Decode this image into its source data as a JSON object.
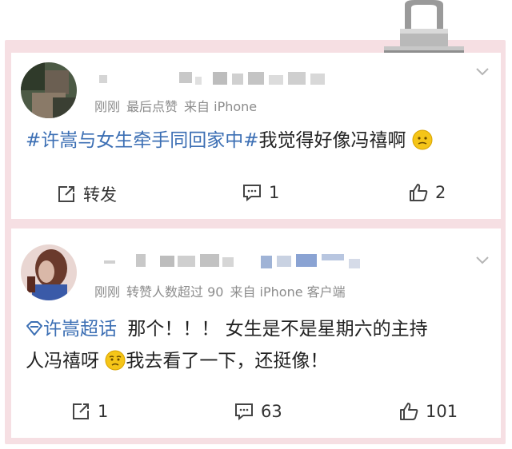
{
  "posts": [
    {
      "meta": {
        "time": "刚刚",
        "tag": "最后点赞",
        "source": "来自 iPhone"
      },
      "content": {
        "hashtag": "#许嵩与女生牵手同回家中#",
        "text": "我觉得好像冯禧啊"
      },
      "actions": {
        "repost": "转发",
        "comments": "1",
        "likes": "2"
      }
    },
    {
      "meta": {
        "time": "刚刚",
        "tag": "转赞人数超过 90",
        "source": "来自 iPhone 客户端"
      },
      "content": {
        "topic": "许嵩超话",
        "line1": "那个！！！ 女生是不是星期六的主持",
        "line2a": "人冯禧呀",
        "line2b": "我去看了一下，还挺像！"
      },
      "actions": {
        "repost": "1",
        "comments": "63",
        "likes": "101"
      }
    }
  ],
  "icons": [
    "repost-icon",
    "comment-icon",
    "like-icon",
    "chevron-down-icon",
    "supertopic-icon",
    "emoji-icon",
    "binder-clip-icon"
  ]
}
